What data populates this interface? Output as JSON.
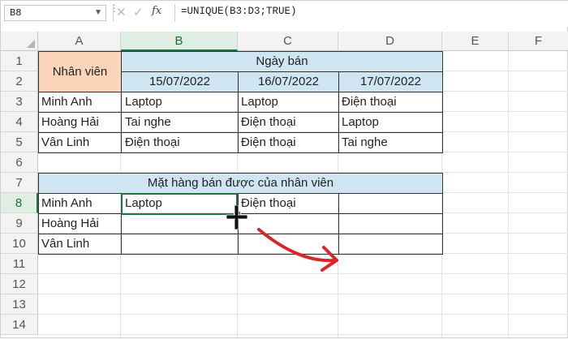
{
  "formula_bar": {
    "name_box": "B8",
    "cancel_icon": "✕",
    "enter_icon": "✓",
    "fx_label": "fx",
    "formula": "=UNIQUE(B3:D3;TRUE)"
  },
  "columns": [
    "A",
    "B",
    "C",
    "D",
    "E",
    "F"
  ],
  "rows": [
    "1",
    "2",
    "3",
    "4",
    "5",
    "6",
    "7",
    "8",
    "9",
    "10",
    "11",
    "12",
    "13",
    "14"
  ],
  "selected_cell": "B8",
  "colors": {
    "header_fill": "#fbd5b9",
    "date_fill": "#cfe5f2",
    "selection": "#217346",
    "arrow": "#d9262b"
  },
  "table1": {
    "header_a": "Nhân viên",
    "header_group": "Ngày bán",
    "dates": [
      "15/07/2022",
      "16/07/2022",
      "17/07/2022"
    ],
    "rows": [
      {
        "name": "Minh Anh",
        "items": [
          "Laptop",
          "Laptop",
          "Điện thoại"
        ]
      },
      {
        "name": "Hoàng Hải",
        "items": [
          "Tai nghe",
          "Điện thoại",
          "Laptop"
        ]
      },
      {
        "name": "Vân Linh",
        "items": [
          "Điện thoại",
          "Điện thoại",
          "Tai nghe"
        ]
      }
    ]
  },
  "table2": {
    "title": "Mặt hàng bán được của nhân viên",
    "rows": [
      {
        "name": "Minh Anh",
        "items": [
          "Laptop",
          "Điện thoại",
          ""
        ]
      },
      {
        "name": "Hoàng Hải",
        "items": [
          "",
          "",
          ""
        ]
      },
      {
        "name": "Vân Linh",
        "items": [
          "",
          "",
          ""
        ]
      }
    ]
  }
}
